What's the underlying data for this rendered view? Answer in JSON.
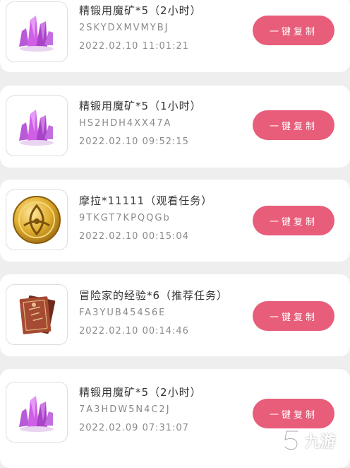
{
  "items": [
    {
      "title": "精锻用魔矿*5（2小时）",
      "code": "2SKYDXMVMYBJ",
      "date": "2022.02.10 11:01:21",
      "button": "一键复制",
      "icon": "purple-crystal-icon"
    },
    {
      "title": "精锻用魔矿*5（1小时）",
      "code": "HS2HDH4XX47A",
      "date": "2022.02.10 09:52:15",
      "button": "一键复制",
      "icon": "purple-crystal-icon"
    },
    {
      "title": "摩拉*11111（观看任务）",
      "code": "9TKGT7KPQQGb",
      "date": "2022.02.10 00:15:04",
      "button": "一键复制",
      "icon": "mora-coin-icon"
    },
    {
      "title": "冒险家的经验*6（推荐任务）",
      "code": "FA3YUB454S6E",
      "date": "2022.02.10 00:14:46",
      "button": "一键复制",
      "icon": "adventurer-book-icon"
    },
    {
      "title": "精锻用魔矿*5（2小时）",
      "code": "7A3HDW5N4C2J",
      "date": "2022.02.09 07:31:07",
      "button": "一键复制",
      "icon": "purple-crystal-icon"
    }
  ],
  "watermark": {
    "text": "九游",
    "icon": "jiuyou-logo-icon"
  },
  "colors": {
    "button": "#e85d7a",
    "background": "#eeeeee",
    "card": "#ffffff"
  }
}
